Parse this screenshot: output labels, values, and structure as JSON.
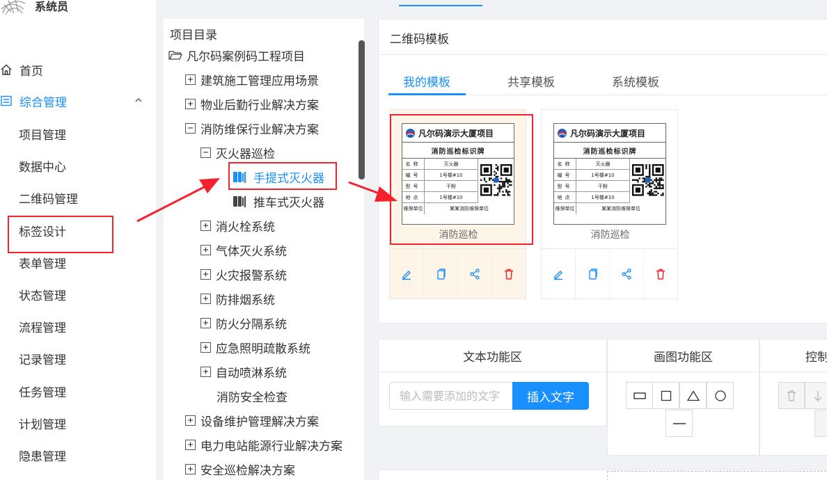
{
  "app": {
    "user_label": "系统员"
  },
  "sidebar": {
    "items": [
      {
        "label": "首页",
        "icon": "home-icon"
      },
      {
        "label": "综合管理",
        "icon": "list-icon",
        "expanded": true
      },
      {
        "label": "项目管理"
      },
      {
        "label": "数据中心"
      },
      {
        "label": "二维码管理"
      },
      {
        "label": "标签设计",
        "highlighted": true
      },
      {
        "label": "表单管理"
      },
      {
        "label": "状态管理"
      },
      {
        "label": "流程管理"
      },
      {
        "label": "记录管理"
      },
      {
        "label": "任务管理"
      },
      {
        "label": "计划管理"
      },
      {
        "label": "隐患管理"
      }
    ]
  },
  "tree": {
    "title": "项目目录",
    "root": "凡尔码案例码工程项目",
    "nodes": [
      {
        "label": "建筑施工管理应用场景",
        "toggle": "+"
      },
      {
        "label": "物业后勤行业解决方案",
        "toggle": "+"
      },
      {
        "label": "消防维保行业解决方案",
        "toggle": "−"
      },
      {
        "label": "灭火器巡检",
        "toggle": "−"
      },
      {
        "label": "手提式灭火器",
        "selected": true
      },
      {
        "label": "推车式灭火器"
      },
      {
        "label": "消火栓系统",
        "toggle": "+"
      },
      {
        "label": "气体灭火系统",
        "toggle": "+"
      },
      {
        "label": "火灾报警系统",
        "toggle": "+"
      },
      {
        "label": "防排烟系统",
        "toggle": "+"
      },
      {
        "label": "防火分隔系统",
        "toggle": "+"
      },
      {
        "label": "应急照明疏散系统",
        "toggle": "+"
      },
      {
        "label": "自动喷淋系统",
        "toggle": "+"
      },
      {
        "label": "消防安全检查"
      },
      {
        "label": "设备维护管理解决方案",
        "toggle": "+"
      },
      {
        "label": "电力电站能源行业解决方案",
        "toggle": "+"
      },
      {
        "label": "安全巡检解决方案",
        "toggle": "+"
      }
    ]
  },
  "templates": {
    "title": "二维码模板",
    "tabs": [
      "我的模板",
      "共享模板",
      "系统模板"
    ],
    "active_tab": 0,
    "cards": [
      {
        "caption": "消防巡检",
        "label": {
          "project": "凡尔码演示大厦项目",
          "subtitle": "消防巡检标识牌",
          "rows": [
            {
              "k": "名称",
              "v": "灭火器"
            },
            {
              "k": "编号",
              "v": "1号楼#10"
            },
            {
              "k": "型号",
              "v": "干粉"
            },
            {
              "k": "地点",
              "v": "1号楼#10"
            },
            {
              "k": "维保单位",
              "v": "某某消防维保单位"
            }
          ]
        }
      },
      {
        "caption": "消防巡检",
        "label": {
          "project": "凡尔码演示大厦项目",
          "subtitle": "消防巡检标识牌",
          "rows": [
            {
              "k": "名称",
              "v": "灭火器"
            },
            {
              "k": "编号",
              "v": "1号楼#10"
            },
            {
              "k": "型号",
              "v": "干粉"
            },
            {
              "k": "地点",
              "v": "1号楼#10"
            },
            {
              "k": "维保单位",
              "v": "某某消防维保单位"
            }
          ]
        }
      }
    ]
  },
  "text_area": {
    "title": "文本功能区",
    "placeholder": "输入需要添加的文字",
    "insert_label": "插入文字"
  },
  "draw_area": {
    "title": "画图功能区",
    "shapes": [
      "rectangle-icon",
      "square-icon",
      "triangle-icon",
      "circle-icon",
      "line-icon"
    ]
  },
  "control_area": {
    "title": "控制"
  },
  "colors": {
    "primary": "#1890ff",
    "highlight": "#f5222d",
    "delete": "#f5222d"
  }
}
